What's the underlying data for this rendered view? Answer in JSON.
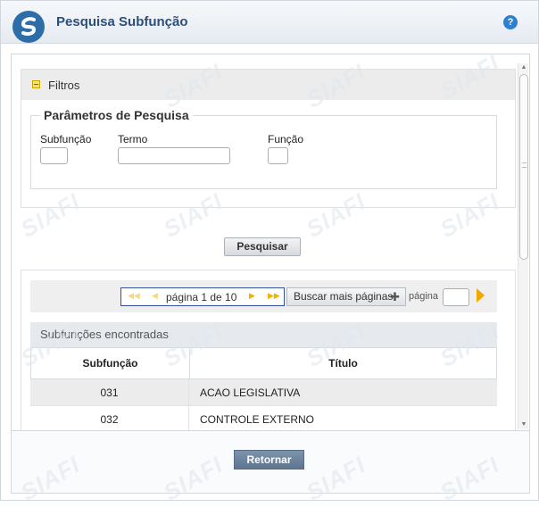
{
  "header": {
    "title": "Pesquisa Subfunção",
    "help_label": "?"
  },
  "filters": {
    "toggle_label": "Filtros",
    "legend": "Parâmetros de Pesquisa",
    "fields": {
      "subfuncao": {
        "label": "Subfunção",
        "value": ""
      },
      "termo": {
        "label": "Termo",
        "value": ""
      },
      "funcao": {
        "label": "Função",
        "value": ""
      }
    },
    "search_button": "Pesquisar"
  },
  "pager": {
    "text": "página 1 de 10",
    "more_button": "Buscar mais páginas",
    "page_label": "página",
    "page_value": ""
  },
  "results": {
    "title": "Subfunções encontradas",
    "columns": [
      "Subfunção",
      "Título"
    ],
    "rows": [
      {
        "code": "031",
        "title": "ACAO LEGISLATIVA"
      },
      {
        "code": "032",
        "title": "CONTROLE EXTERNO"
      }
    ]
  },
  "footer": {
    "return_button": "Retornar"
  },
  "watermark": "SIAFI",
  "colors": {
    "title": "#2b4f79",
    "accent": "#2e6ea8",
    "pager_arrow": "#f0b400"
  }
}
